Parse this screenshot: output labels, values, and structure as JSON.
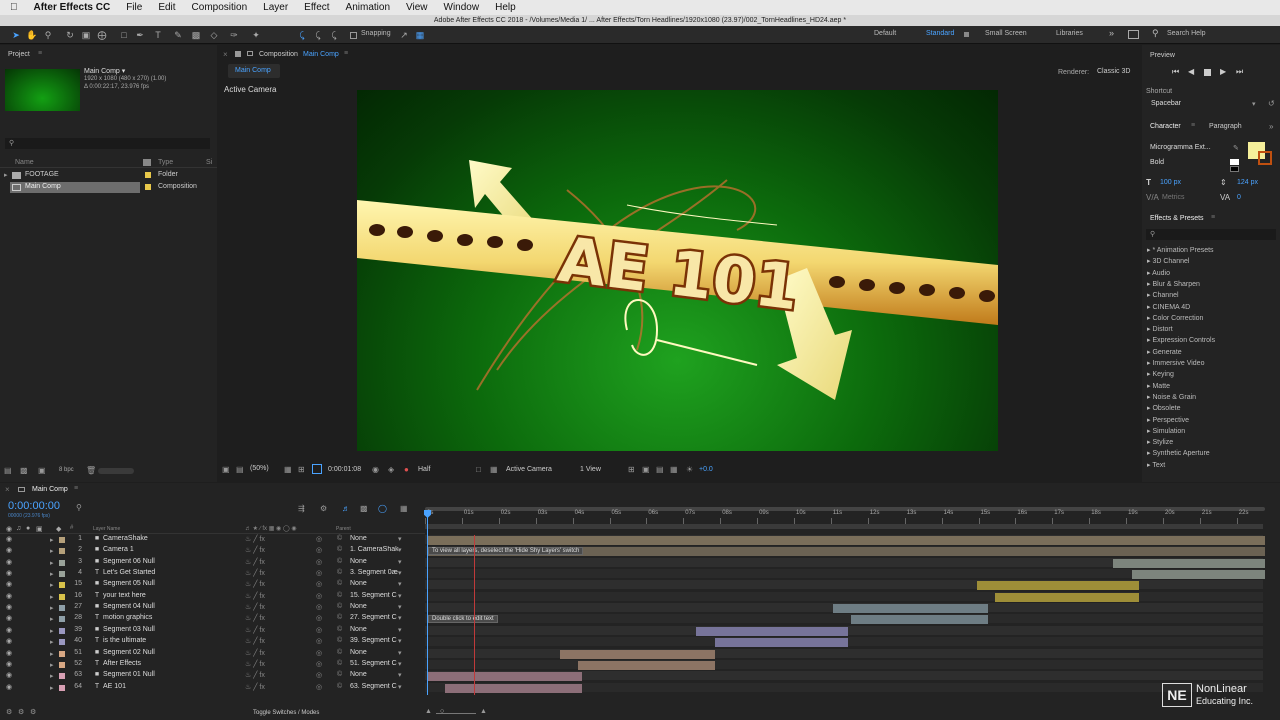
{
  "menubar": {
    "app": "After Effects CC",
    "items": [
      "File",
      "Edit",
      "Composition",
      "Layer",
      "Effect",
      "Animation",
      "View",
      "Window",
      "Help"
    ]
  },
  "titlebar": "Adobe After Effects CC 2018 - /Volumes/Media 1/ ... After Effects/Torn Headlines/1920x1080 (23.97)/002_TornHeadlines_HD24.aep *",
  "toolbar": {
    "snapping": "Snapping",
    "workspaces": [
      "Default",
      "Standard",
      "Small Screen",
      "Libraries"
    ],
    "active_workspace": "Standard",
    "search_placeholder": "Search Help"
  },
  "project": {
    "tab": "Project",
    "comp_name": "Main Comp ▾",
    "comp_info1": "1920 x 1080 (480 x 270) (1.00)",
    "comp_info2": "Δ 0:00:22:17, 23.976 fps",
    "col_name": "Name",
    "col_type": "Type",
    "col_size": "Si",
    "items": [
      {
        "name": "FOOTAGE",
        "type": "Folder",
        "color": "#e8c84a"
      },
      {
        "name": "Main Comp",
        "type": "Composition",
        "color": "#e8c84a"
      }
    ],
    "bpc": "8 bpc"
  },
  "composition": {
    "tab_prefix": "Composition",
    "tab_name": "Main Comp",
    "subtab": "Main Comp",
    "renderer_label": "Renderer:",
    "renderer": "Classic 3D",
    "camera_label": "Active Camera",
    "zoom": "(50%)",
    "time": "0:00:01:08",
    "resolution": "Half",
    "view": "Active Camera",
    "views": "1 View",
    "exposure": "+0.0"
  },
  "artwork": {
    "title": "AE 101"
  },
  "preview": {
    "tab": "Preview",
    "shortcut_label": "Shortcut",
    "shortcut": "Spacebar"
  },
  "character": {
    "tab": "Character",
    "tab2": "Paragraph",
    "font": "Microgramma Ext...",
    "style": "Bold",
    "size": "100 px",
    "leading": "124 px",
    "kerning": "Metrics",
    "tracking": "0",
    "fill_color": "#f5ef9a"
  },
  "effects": {
    "tab": "Effects & Presets",
    "search_placeholder": "⌕ₐ",
    "items": [
      "* Animation Presets",
      "3D Channel",
      "Audio",
      "Blur & Sharpen",
      "Channel",
      "CINEMA 4D",
      "Color Correction",
      "Distort",
      "Expression Controls",
      "Generate",
      "Immersive Video",
      "Keying",
      "Matte",
      "Noise & Grain",
      "Obsolete",
      "Perspective",
      "Simulation",
      "Stylize",
      "Synthetic Aperture",
      "Text"
    ]
  },
  "timeline": {
    "tab": "Main Comp",
    "timecode": "0:00:00:00",
    "fps": "00000 (23.976 fps)",
    "col_layer": "Layer Name",
    "col_parent": "Parent",
    "ruler": [
      "0s",
      "01s",
      "02s",
      "03s",
      "04s",
      "05s",
      "06s",
      "07s",
      "08s",
      "09s",
      "10s",
      "11s",
      "12s",
      "13s",
      "14s",
      "15s",
      "16s",
      "17s",
      "18s",
      "19s",
      "20s",
      "21s",
      "22s"
    ],
    "tooltip1": "To view all layers, deselect the 'Hide Shy Layers' switch",
    "tooltip2": "Double click to edit text",
    "toggle_label": "Toggle Switches / Modes",
    "layers": [
      {
        "num": "1",
        "name": "CameraShake",
        "type": "■",
        "parent": "None",
        "label": "#b5a07a",
        "bar_start": 0,
        "bar_end": 23,
        "bar_color": "#7a6e5a"
      },
      {
        "num": "2",
        "name": "Camera 1",
        "type": "■",
        "parent": "1. CameraShak",
        "label": "#b5a07a",
        "bar_start": 0,
        "bar_end": 23,
        "bar_color": "#6b6253"
      },
      {
        "num": "3",
        "name": "Segment 06 Null",
        "type": "■",
        "parent": "None",
        "label": "#9aa39a",
        "bar_start": 18.6,
        "bar_end": 23,
        "bar_color": "#7d857d"
      },
      {
        "num": "4",
        "name": "Let's Get Started",
        "type": "T",
        "parent": "3. Segment 0æ",
        "label": "#9aa39a",
        "bar_start": 19.1,
        "bar_end": 23,
        "bar_color": "#7d857d"
      },
      {
        "num": "15",
        "name": "Segment 05 Null",
        "type": "■",
        "parent": "None",
        "label": "#d8c24a",
        "bar_start": 14.9,
        "bar_end": 19.3,
        "bar_color": "#9e8e38"
      },
      {
        "num": "16",
        "name": "your text here",
        "type": "T",
        "parent": "15. Segment C",
        "label": "#d8c24a",
        "bar_start": 15.4,
        "bar_end": 19.3,
        "bar_color": "#9e8e38"
      },
      {
        "num": "27",
        "name": "Segment 04 Null",
        "type": "■",
        "parent": "None",
        "label": "#8fa0a8",
        "bar_start": 11,
        "bar_end": 15.2,
        "bar_color": "#6e7d84"
      },
      {
        "num": "28",
        "name": "motion graphics",
        "type": "T",
        "parent": "27. Segment C",
        "label": "#8fa0a8",
        "bar_start": 11.5,
        "bar_end": 15.2,
        "bar_color": "#6e7d84"
      },
      {
        "num": "39",
        "name": "Segment 03 Null",
        "type": "■",
        "parent": "None",
        "label": "#9a97c0",
        "bar_start": 7.3,
        "bar_end": 11.4,
        "bar_color": "#77749a"
      },
      {
        "num": "40",
        "name": "is the ultimate",
        "type": "T",
        "parent": "39. Segment C",
        "label": "#9a97c0",
        "bar_start": 7.8,
        "bar_end": 11.4,
        "bar_color": "#77749a"
      },
      {
        "num": "51",
        "name": "Segment 02 Null",
        "type": "■",
        "parent": "None",
        "label": "#d8a884",
        "bar_start": 3.6,
        "bar_end": 7.8,
        "bar_color": "#8c7464"
      },
      {
        "num": "52",
        "name": "After Effects",
        "type": "T",
        "parent": "51. Segment C",
        "label": "#d8a884",
        "bar_start": 4.1,
        "bar_end": 7.8,
        "bar_color": "#8c7464"
      },
      {
        "num": "63",
        "name": "Segment 01 Null",
        "type": "■",
        "parent": "None",
        "label": "#d8a0b4",
        "bar_start": 0,
        "bar_end": 4.2,
        "bar_color": "#8c6e78"
      },
      {
        "num": "64",
        "name": "AE 101",
        "type": "T",
        "parent": "63. Segment C",
        "label": "#d8a0b4",
        "bar_start": 0.5,
        "bar_end": 4.2,
        "bar_color": "#8c6e78"
      }
    ]
  },
  "watermark": {
    "brand": "NE",
    "line1": "NonLinear",
    "line2": "Educating Inc."
  }
}
